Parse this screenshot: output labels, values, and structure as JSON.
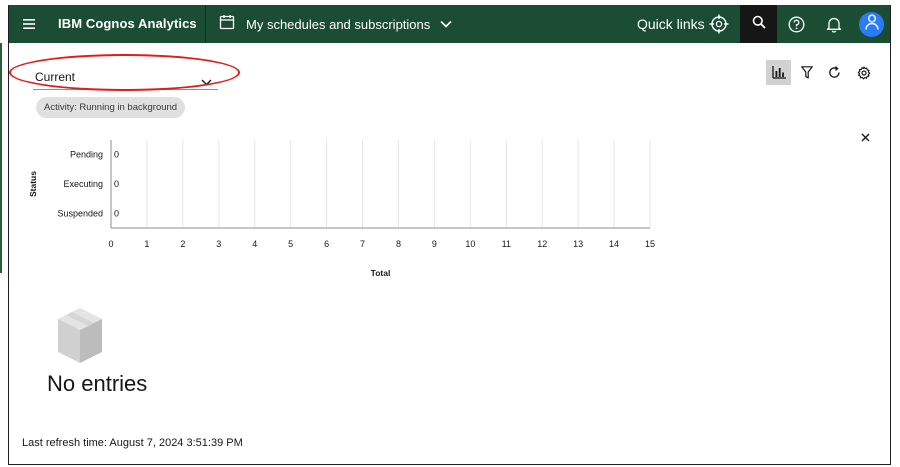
{
  "header": {
    "app_title": "IBM Cognos Analytics",
    "context_label": "My schedules and subscriptions",
    "quick_links": "Quick links",
    "menu_icon": "hamburger-menu-icon",
    "context_icon": "calendar-icon",
    "colors": {
      "bar": "#1b4d35",
      "search_active": "#161616",
      "avatar": "#2b7bf7"
    }
  },
  "filter": {
    "selected": "Current",
    "activity_tag": "Activity: Running in background"
  },
  "toolbar": {
    "chart_toggle": "bar-chart-icon",
    "filter": "filter-icon",
    "refresh": "refresh-icon",
    "settings": "gear-icon"
  },
  "chart_data": {
    "type": "bar",
    "orientation": "horizontal",
    "categories": [
      "Pending",
      "Executing",
      "Suspended"
    ],
    "values": [
      0,
      0,
      0
    ],
    "data_labels": [
      "0",
      "0",
      "0"
    ],
    "xlabel": "Total",
    "ylabel": "Status",
    "xlim": [
      0,
      15
    ],
    "x_ticks": [
      "0",
      "1",
      "2",
      "3",
      "4",
      "5",
      "6",
      "7",
      "8",
      "9",
      "10",
      "11",
      "12",
      "13",
      "14",
      "15"
    ],
    "grid": true,
    "legend": "none"
  },
  "empty_state": {
    "title": "No entries",
    "icon": "empty-box-icon"
  },
  "footer": {
    "refresh_text": "Last refresh time: August 7, 2024 3:51:39 PM"
  },
  "annotation": {
    "color": "#e01b1b"
  }
}
